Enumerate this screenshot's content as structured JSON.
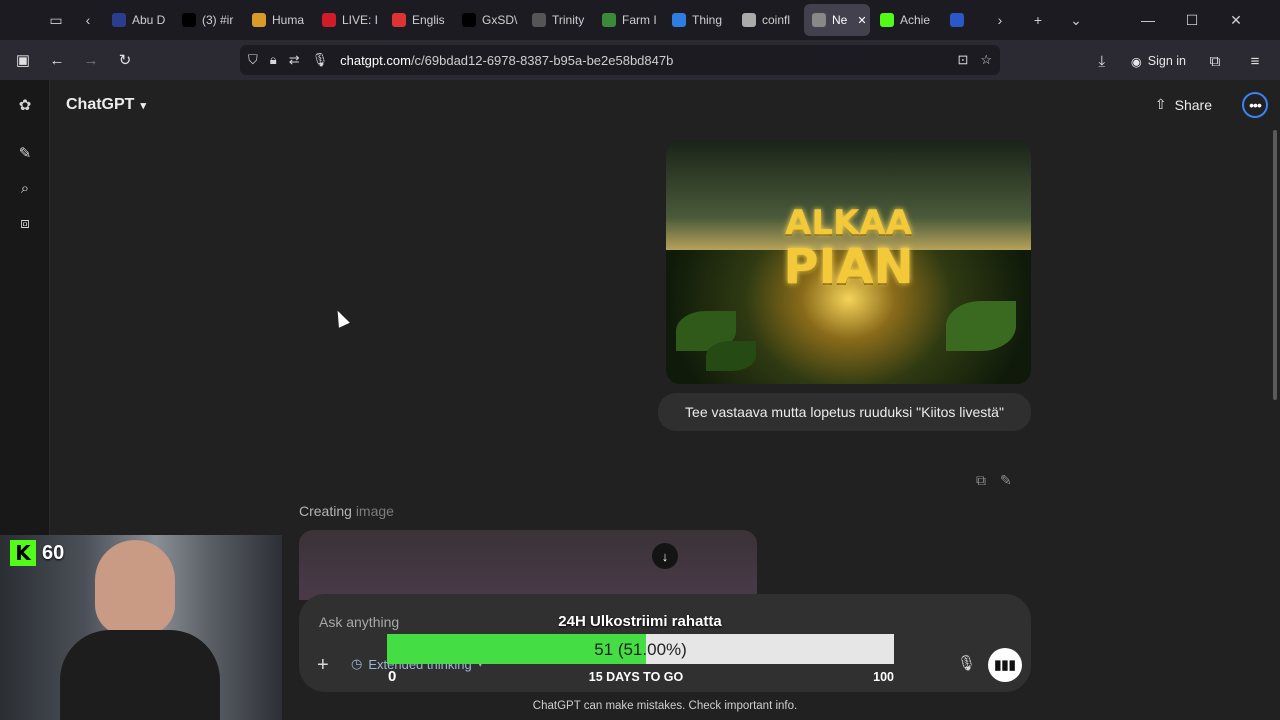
{
  "browser": {
    "tabs": [
      {
        "label": "Abu D",
        "color": "#2a3d8f"
      },
      {
        "label": "(3) #ir",
        "color": "#000000"
      },
      {
        "label": "Huma",
        "color": "#d89a2b"
      },
      {
        "label": "LIVE: I",
        "color": "#d11a2a"
      },
      {
        "label": "Englis",
        "color": "#d33"
      },
      {
        "label": "GxSD\\",
        "color": "#000000"
      },
      {
        "label": "Trinity",
        "color": "#555555"
      },
      {
        "label": "Farm I",
        "color": "#3a8a3a"
      },
      {
        "label": "Thing",
        "color": "#2f7de1"
      },
      {
        "label": "coinfl",
        "color": "#aaaaaa"
      },
      {
        "label": "Ne",
        "color": "#888888",
        "active": true
      },
      {
        "label": "Achie",
        "color": "#53fc18"
      },
      {
        "label": "",
        "color": "#2a58c8"
      }
    ],
    "url_prefix": "chatgpt.com",
    "url_rest": "/c/69bdad12-6978-8387-b95a-be2e58bd847b",
    "sign_in": "Sign in"
  },
  "app": {
    "model_name": "ChatGPT",
    "share_label": "Share"
  },
  "chat": {
    "image_text_line1": "ALKAA",
    "image_text_line2": "PIAN",
    "user_message": "Tee vastaava mutta lopetus ruuduksi \"Kiitos livestä\"",
    "creating_label": "Creating",
    "creating_label_faint": "image"
  },
  "composer": {
    "placeholder": "Ask anything",
    "thinking_label": "Extended thinking"
  },
  "disclaimer": "ChatGPT can make mistakes. Check important info.",
  "stream_overlay": {
    "title": "24H Ulkostriimi rahatta",
    "progress_fraction": 0.51,
    "bar_text": "51 (51.00%)",
    "min_label": "0",
    "days_label": "15 DAYS TO GO",
    "max_label": "100",
    "fill_color": "#44dd44"
  },
  "webcam": {
    "kick_logo": "K",
    "viewer_count": "60"
  }
}
